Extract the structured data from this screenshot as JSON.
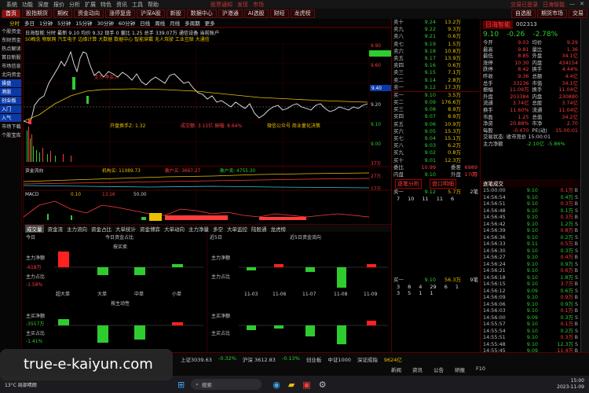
{
  "menu": {
    "items": [
      "系统",
      "功能",
      "深度",
      "报价",
      "分析",
      "扩展",
      "特色",
      "资讯",
      "工具",
      "帮助"
    ],
    "right": [
      "交易已登录",
      "日海智能"
    ],
    "alerts": [
      "股票通知",
      "发现",
      "市场"
    ]
  },
  "tabs": {
    "left": [
      "首页",
      "股指期货",
      "期权",
      "资金动向",
      "涨停复盘",
      "沪深A股",
      "股东"
    ],
    "middle": [
      "沪深A股",
      "新股",
      "数据中心",
      "沪港通",
      "AI选股",
      "财经",
      "龙虎榜"
    ],
    "right": [
      "自选股",
      "期货市场",
      "交易"
    ]
  },
  "sub_toolbar": [
    "分时",
    "多日",
    "1分钟",
    "5分钟",
    "15分钟",
    "30分钟",
    "60分钟",
    "日线",
    "周线",
    "月线",
    "多周期",
    "更多"
  ],
  "sidebar": [
    "个股资金",
    "东财资金",
    "热点解读",
    "首日新股",
    "市场信息",
    "北向资金",
    "操盘",
    "港股",
    "创业板",
    "入门",
    "入气",
    "市场下载",
    "个股宝库"
  ],
  "chart": {
    "stock": "日海智能",
    "price_label": "9.10",
    "ylabels": [
      "9.90",
      "9.60",
      "9.40",
      "9.20",
      "9.10",
      "9.00",
      "8.80",
      "8.60",
      "8.50"
    ],
    "volume_labels": [
      "37万",
      "27万",
      "17万"
    ],
    "pct_labels": [
      "4.97%",
      "2.75%",
      "0.00%",
      "-1.29%",
      "-3.00%"
    ],
    "time_labels": [
      "09:30",
      "10:30",
      "11:30/13:00",
      "14:00",
      "15:00"
    ],
    "top_info": "日海智能  分时  最新 9.10  均价 9.32  现手 0  量比 1.25  总手 339.07万  通信设备  当前账户",
    "tags": "50概念  物联网  汽车电子  边缘计算  大数据  数据中心  智能穿戴  无人驾驶  工业互联  大通信",
    "annot1": "开盘换手Z: 1.32",
    "annot2": "成交额: 3.15亿  振幅: 8.64%",
    "annot3": "微信公众号  商业量化决策",
    "flow_label": "资金流向",
    "flow_vals": [
      "机构买: 11089.73",
      "散户买: 3667.27",
      "散户卖: 4755.30"
    ],
    "ind_label": "MACD",
    "ind_vals": [
      "0.10",
      "13.16",
      "50.00"
    ],
    "red_box": "主力 净买入"
  },
  "bottom_tabs": [
    "成交量",
    "资金流",
    "主力流向",
    "资金占比",
    "大单统计",
    "资金博弈",
    "大单动向",
    "主力净量",
    "多空",
    "大单监控",
    "陆股通",
    "龙虎榜",
    "资金",
    "财务",
    "数据",
    "融资融券"
  ],
  "bottom": {
    "today": "今日",
    "today_big": "今日资金占比",
    "left_title": "按买卖",
    "five_days": "近5日",
    "five_title": "近5日资金流向",
    "main_net": "主力净额",
    "main_ratio": "主力占比",
    "main_net_val": "-618万",
    "main_ratio_val": "-1.58%",
    "cats": [
      "超大单",
      "大单",
      "中单",
      "小单"
    ],
    "dates": [
      "11-03",
      "11-06",
      "11-07",
      "11-08",
      "11-09"
    ],
    "second_title": "按主动性",
    "net_buy": "主买净额",
    "buy_ratio": "主买占比",
    "net_buy_val": "-3557万",
    "buy_ratio_val": "-1.41%"
  },
  "quote": {
    "sell": [
      [
        "卖十",
        "9.24",
        "13.2万"
      ],
      [
        "卖九",
        "9.22",
        "9.3万"
      ],
      [
        "卖八",
        "9.21",
        "0.6万"
      ],
      [
        "卖七",
        "9.19",
        "1.5万"
      ],
      [
        "卖六",
        "9.18",
        "10.8万"
      ],
      [
        "卖五",
        "9.17",
        "13.9万"
      ],
      [
        "卖四",
        "9.16",
        "0.6万"
      ],
      [
        "卖三",
        "9.15",
        "7.1万"
      ],
      [
        "卖二",
        "9.14",
        "2.8万"
      ],
      [
        "卖一",
        "9.12",
        "17.3万"
      ]
    ],
    "buy": [
      [
        "买一",
        "9.10",
        "3.5万"
      ],
      [
        "买二",
        "9.09",
        "176.6万"
      ],
      [
        "买三",
        "9.08",
        "8.9万"
      ],
      [
        "买四",
        "9.07",
        "8.9万"
      ],
      [
        "买五",
        "9.06",
        "10.9万"
      ],
      [
        "买六",
        "9.05",
        "15.3万"
      ],
      [
        "买七",
        "9.04",
        "15.1万"
      ],
      [
        "买八",
        "9.03",
        "6.2万"
      ],
      [
        "买九",
        "9.02",
        "0.8万"
      ],
      [
        "买十",
        "9.01",
        "12.3万"
      ]
    ],
    "foot": [
      "委比",
      "10.99",
      "委差",
      "6989万"
    ],
    "foot2": [
      "内盘",
      "9.10",
      "外盘",
      "1703万"
    ]
  },
  "stockinfo": {
    "name": "日海智能",
    "code": "002313",
    "price": "9.10",
    "change": "-0.26",
    "pct": "-2.78%",
    "rows": [
      [
        "今开",
        "9.03",
        "均价",
        "9.29"
      ],
      [
        "最高",
        "9.81",
        "量比",
        "1.36"
      ],
      [
        "最低",
        "8.85",
        "外盘",
        "34.1亿"
      ],
      [
        "涨停",
        "10.30",
        "内盘",
        "434154"
      ],
      [
        "跌停",
        "8.42",
        "换手",
        "4.44%"
      ],
      [
        "昨收",
        "9.36",
        "总额",
        "4.4亿"
      ],
      [
        "总手",
        "33236",
        "市值",
        "34.1亿"
      ],
      [
        "振幅",
        "11.09万",
        "换手",
        "11.04亿"
      ],
      [
        "外盘",
        "203384",
        "内盘",
        "230880"
      ],
      [
        "流通",
        "3.74亿",
        "总股",
        "3.74亿"
      ],
      [
        "换手",
        "11.60%",
        "流通",
        "11.04亿"
      ],
      [
        "市盈",
        "1.25",
        "总值",
        "34.2亿"
      ],
      [
        "净资",
        "20.88%",
        "市净",
        "2.70"
      ],
      [
        "每股",
        "-0.470",
        "PE(动)",
        "15:00:01"
      ]
    ],
    "sub": "交易状态: 收市竞价  15:00:01",
    "main": "主力净额",
    "main_val": "-2.10亿",
    "main_val2": "-5.86%"
  },
  "ticks_header": "逐笔成交",
  "ticks": [
    [
      "15:00:00",
      "9.10",
      "0.1万",
      "B"
    ],
    [
      "14:56:54",
      "9.10",
      "0.4万",
      "S"
    ],
    [
      "14:56:51",
      "9.10",
      "0.3万",
      "B"
    ],
    [
      "14:56:48",
      "9.10",
      "0.1万",
      "S"
    ],
    [
      "14:56:45",
      "9.10",
      "0.3万",
      "B"
    ],
    [
      "14:56:42",
      "9.10",
      "1.2万",
      "S"
    ],
    [
      "14:56:39",
      "9.10",
      "0.8万",
      "B"
    ],
    [
      "14:56:36",
      "9.10",
      "0.2万",
      "S"
    ],
    [
      "14:56:33",
      "9.11",
      "0.5万",
      "B"
    ],
    [
      "14:56:30",
      "9.10",
      "0.3万",
      "S"
    ],
    [
      "14:56:27",
      "9.10",
      "0.4万",
      "B"
    ],
    [
      "14:56:24",
      "9.10",
      "0.9万",
      "S"
    ],
    [
      "14:56:21",
      "9.10",
      "0.6万",
      "B"
    ],
    [
      "14:56:18",
      "9.10",
      "1.8万",
      "S"
    ],
    [
      "14:56:15",
      "9.10",
      "3.7万",
      "B"
    ],
    [
      "14:56:12",
      "9.09",
      "0.6万",
      "S"
    ],
    [
      "14:56:09",
      "9.10",
      "0.9万",
      "B"
    ],
    [
      "14:56:06",
      "9.10",
      "0.9万",
      "S"
    ],
    [
      "14:56:03",
      "9.10",
      "0.1万",
      "B"
    ],
    [
      "14:56:00",
      "9.09",
      "0.3万",
      "S"
    ],
    [
      "14:55:57",
      "9.10",
      "0.1万",
      "B"
    ],
    [
      "14:55:54",
      "9.10",
      "0.2万",
      "S"
    ],
    [
      "14:55:51",
      "9.10",
      "0.3万",
      "B"
    ],
    [
      "14:55:48",
      "9.10",
      "12.3万",
      "S"
    ],
    [
      "14:55:45",
      "9.09",
      "11.4万",
      "B"
    ]
  ],
  "mid": {
    "title": "逐笔分析",
    "title2": "盘口明细",
    "row1": [
      "卖一",
      "9.12",
      "5.7万",
      "2笔"
    ],
    "nums1": [
      "7",
      "10",
      "11",
      "11",
      "6"
    ],
    "row2": [
      "买一",
      "9.10",
      "56.3万",
      "9笔"
    ],
    "nums2": [
      "3",
      "8",
      "4",
      "29",
      "6",
      "1"
    ],
    "nums3": [
      "3",
      "5",
      "1",
      "1"
    ]
  },
  "status": {
    "items": [
      "上证3039.63",
      "-0.32%",
      "沪深 3612.83",
      "-0.13%",
      "创业板",
      "中证1000",
      "深证成指",
      "9624亿"
    ],
    "tabs": [
      "新闻",
      "资讯",
      "公告",
      "研报",
      "F10"
    ]
  },
  "watermark": "true-e-kaiyun.com",
  "taskbar": {
    "search": "搜索",
    "weather": "13°C 局部晴朗",
    "time": "15:00",
    "date": "2023-11-09"
  }
}
